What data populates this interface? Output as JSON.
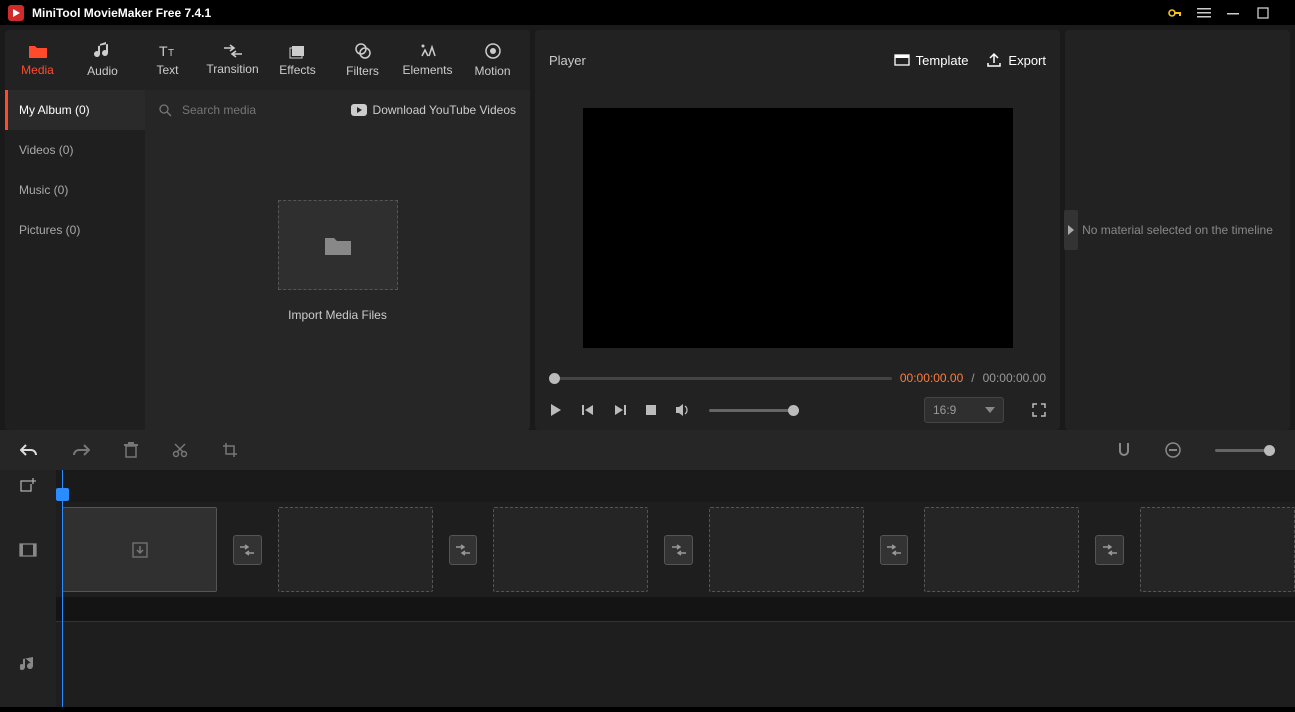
{
  "titlebar": {
    "title": "MiniTool MovieMaker Free 7.4.1"
  },
  "tabs": [
    {
      "label": "Media"
    },
    {
      "label": "Audio"
    },
    {
      "label": "Text"
    },
    {
      "label": "Transition"
    },
    {
      "label": "Effects"
    },
    {
      "label": "Filters"
    },
    {
      "label": "Elements"
    },
    {
      "label": "Motion"
    }
  ],
  "sidebar": {
    "items": [
      {
        "label": "My Album (0)"
      },
      {
        "label": "Videos (0)"
      },
      {
        "label": "Music (0)"
      },
      {
        "label": "Pictures (0)"
      }
    ]
  },
  "media": {
    "search_placeholder": "Search media",
    "youtube_link": "Download YouTube Videos",
    "import_label": "Import Media Files"
  },
  "player": {
    "title": "Player",
    "template_label": "Template",
    "export_label": "Export",
    "time_current": "00:00:00.00",
    "time_sep": " / ",
    "time_total": "00:00:00.00",
    "aspect": "16:9"
  },
  "right_panel": {
    "message": "No material selected on the timeline"
  }
}
